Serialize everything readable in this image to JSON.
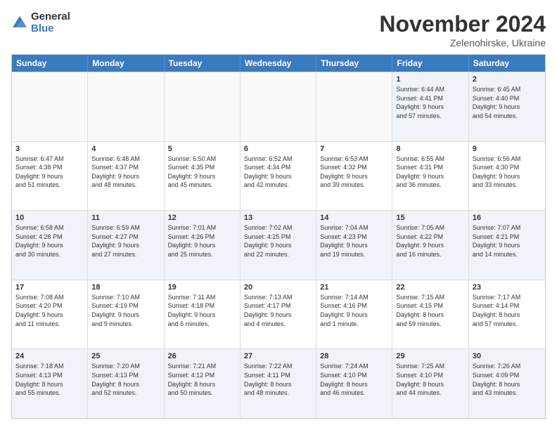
{
  "logo": {
    "general": "General",
    "blue": "Blue"
  },
  "header": {
    "month": "November 2024",
    "location": "Zelenohirske, Ukraine"
  },
  "days": [
    "Sunday",
    "Monday",
    "Tuesday",
    "Wednesday",
    "Thursday",
    "Friday",
    "Saturday"
  ],
  "rows": [
    [
      {
        "day": "",
        "text": "",
        "empty": true
      },
      {
        "day": "",
        "text": "",
        "empty": true
      },
      {
        "day": "",
        "text": "",
        "empty": true
      },
      {
        "day": "",
        "text": "",
        "empty": true
      },
      {
        "day": "",
        "text": "",
        "empty": true
      },
      {
        "day": "1",
        "text": "Sunrise: 6:44 AM\nSunset: 4:41 PM\nDaylight: 9 hours\nand 57 minutes.",
        "empty": false
      },
      {
        "day": "2",
        "text": "Sunrise: 6:45 AM\nSunset: 4:40 PM\nDaylight: 9 hours\nand 54 minutes.",
        "empty": false
      }
    ],
    [
      {
        "day": "3",
        "text": "Sunrise: 6:47 AM\nSunset: 4:38 PM\nDaylight: 9 hours\nand 51 minutes.",
        "empty": false
      },
      {
        "day": "4",
        "text": "Sunrise: 6:48 AM\nSunset: 4:37 PM\nDaylight: 9 hours\nand 48 minutes.",
        "empty": false
      },
      {
        "day": "5",
        "text": "Sunrise: 6:50 AM\nSunset: 4:35 PM\nDaylight: 9 hours\nand 45 minutes.",
        "empty": false
      },
      {
        "day": "6",
        "text": "Sunrise: 6:52 AM\nSunset: 4:34 PM\nDaylight: 9 hours\nand 42 minutes.",
        "empty": false
      },
      {
        "day": "7",
        "text": "Sunrise: 6:53 AM\nSunset: 4:32 PM\nDaylight: 9 hours\nand 39 minutes.",
        "empty": false
      },
      {
        "day": "8",
        "text": "Sunrise: 6:55 AM\nSunset: 4:31 PM\nDaylight: 9 hours\nand 36 minutes.",
        "empty": false
      },
      {
        "day": "9",
        "text": "Sunrise: 6:56 AM\nSunset: 4:30 PM\nDaylight: 9 hours\nand 33 minutes.",
        "empty": false
      }
    ],
    [
      {
        "day": "10",
        "text": "Sunrise: 6:58 AM\nSunset: 4:28 PM\nDaylight: 9 hours\nand 30 minutes.",
        "empty": false
      },
      {
        "day": "11",
        "text": "Sunrise: 6:59 AM\nSunset: 4:27 PM\nDaylight: 9 hours\nand 27 minutes.",
        "empty": false
      },
      {
        "day": "12",
        "text": "Sunrise: 7:01 AM\nSunset: 4:26 PM\nDaylight: 9 hours\nand 25 minutes.",
        "empty": false
      },
      {
        "day": "13",
        "text": "Sunrise: 7:02 AM\nSunset: 4:25 PM\nDaylight: 9 hours\nand 22 minutes.",
        "empty": false
      },
      {
        "day": "14",
        "text": "Sunrise: 7:04 AM\nSunset: 4:23 PM\nDaylight: 9 hours\nand 19 minutes.",
        "empty": false
      },
      {
        "day": "15",
        "text": "Sunrise: 7:05 AM\nSunset: 4:22 PM\nDaylight: 9 hours\nand 16 minutes.",
        "empty": false
      },
      {
        "day": "16",
        "text": "Sunrise: 7:07 AM\nSunset: 4:21 PM\nDaylight: 9 hours\nand 14 minutes.",
        "empty": false
      }
    ],
    [
      {
        "day": "17",
        "text": "Sunrise: 7:08 AM\nSunset: 4:20 PM\nDaylight: 9 hours\nand 11 minutes.",
        "empty": false
      },
      {
        "day": "18",
        "text": "Sunrise: 7:10 AM\nSunset: 4:19 PM\nDaylight: 9 hours\nand 9 minutes.",
        "empty": false
      },
      {
        "day": "19",
        "text": "Sunrise: 7:11 AM\nSunset: 4:18 PM\nDaylight: 9 hours\nand 6 minutes.",
        "empty": false
      },
      {
        "day": "20",
        "text": "Sunrise: 7:13 AM\nSunset: 4:17 PM\nDaylight: 9 hours\nand 4 minutes.",
        "empty": false
      },
      {
        "day": "21",
        "text": "Sunrise: 7:14 AM\nSunset: 4:16 PM\nDaylight: 9 hours\nand 1 minute.",
        "empty": false
      },
      {
        "day": "22",
        "text": "Sunrise: 7:15 AM\nSunset: 4:15 PM\nDaylight: 8 hours\nand 59 minutes.",
        "empty": false
      },
      {
        "day": "23",
        "text": "Sunrise: 7:17 AM\nSunset: 4:14 PM\nDaylight: 8 hours\nand 57 minutes.",
        "empty": false
      }
    ],
    [
      {
        "day": "24",
        "text": "Sunrise: 7:18 AM\nSunset: 4:13 PM\nDaylight: 8 hours\nand 55 minutes.",
        "empty": false
      },
      {
        "day": "25",
        "text": "Sunrise: 7:20 AM\nSunset: 4:13 PM\nDaylight: 8 hours\nand 52 minutes.",
        "empty": false
      },
      {
        "day": "26",
        "text": "Sunrise: 7:21 AM\nSunset: 4:12 PM\nDaylight: 8 hours\nand 50 minutes.",
        "empty": false
      },
      {
        "day": "27",
        "text": "Sunrise: 7:22 AM\nSunset: 4:11 PM\nDaylight: 8 hours\nand 48 minutes.",
        "empty": false
      },
      {
        "day": "28",
        "text": "Sunrise: 7:24 AM\nSunset: 4:10 PM\nDaylight: 8 hours\nand 46 minutes.",
        "empty": false
      },
      {
        "day": "29",
        "text": "Sunrise: 7:25 AM\nSunset: 4:10 PM\nDaylight: 8 hours\nand 44 minutes.",
        "empty": false
      },
      {
        "day": "30",
        "text": "Sunrise: 7:26 AM\nSunset: 4:09 PM\nDaylight: 8 hours\nand 43 minutes.",
        "empty": false
      }
    ]
  ]
}
